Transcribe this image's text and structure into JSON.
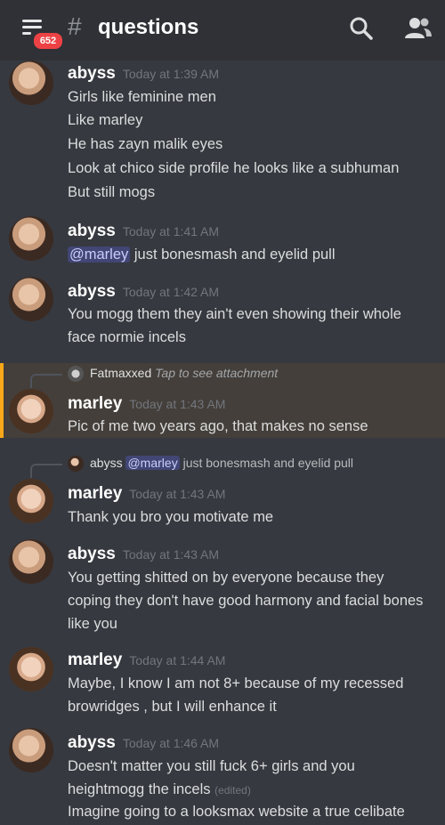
{
  "header": {
    "badge_count": "652",
    "hash_symbol": "#",
    "channel_name": "questions",
    "icons": {
      "menu": "hamburger-menu-icon",
      "search": "search-icon",
      "members": "members-icon"
    }
  },
  "colors": {
    "background": "#36393f",
    "topbar": "#2f3136",
    "badge": "#ed4245",
    "mention_bg": "#414675",
    "highlight_bar": "#faa81a"
  },
  "messages": [
    {
      "author": "abyss",
      "time": "Today at 1:39 AM",
      "lines": [
        "Girls like feminine men",
        "Like marley",
        "He has zayn malik eyes",
        "Look at chico side profile he looks like a subhuman",
        "But still mogs"
      ]
    },
    {
      "author": "abyss",
      "time": "Today at 1:41 AM",
      "mention": "@marley",
      "text": "just bonesmash and eyelid pull"
    },
    {
      "author": "abyss",
      "time": "Today at 1:42 AM",
      "lines": [
        "You mogg them they ain't even showing their whole",
        "face normie incels"
      ]
    },
    {
      "reply": {
        "author": "Fatmaxxed",
        "text": "Tap to see attachment"
      },
      "author": "marley",
      "time": "Today at 1:43 AM",
      "lines": [
        "Pic of me two years ago, that makes no sense"
      ]
    },
    {
      "reply": {
        "author": "abyss",
        "mention": "@marley",
        "text": "just bonesmash and eyelid pull"
      },
      "author": "marley",
      "time": "Today at 1:43 AM",
      "lines": [
        "Thank you bro you motivate me"
      ]
    },
    {
      "author": "abyss",
      "time": "Today at 1:43 AM",
      "lines": [
        "You getting shitted on by everyone because they",
        "coping they don't have good harmony and facial bones",
        "like you"
      ]
    },
    {
      "author": "marley",
      "time": "Today at 1:44 AM",
      "lines": [
        "Maybe, I know I am not 8+ because of my recessed",
        "browridges , but I will enhance it"
      ]
    },
    {
      "author": "abyss",
      "time": "Today at 1:46 AM",
      "lines": [
        "Doesn't matter you still fuck 6+ girls and you",
        "heightmogg the incels",
        "Imagine going to a looksmax website a true celibate"
      ],
      "edited": "(edited)"
    }
  ]
}
